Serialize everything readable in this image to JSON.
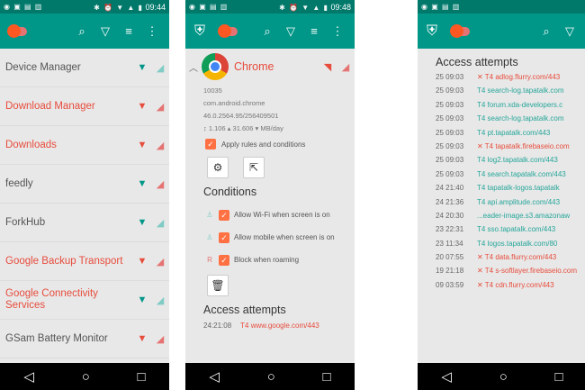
{
  "status_bar": {
    "left_icons": "◉ ▣ ▤ ▥",
    "right_icons": "✱ ⏰ ▼ ▲ ▮",
    "time_1": "09:44",
    "time_2": "09:48"
  },
  "toolbar": {
    "icons": [
      "search-icon",
      "filter-icon",
      "sort-icon",
      "overflow-menu-icon"
    ]
  },
  "navbar": {
    "back": "◁",
    "home": "○",
    "recents": "□"
  },
  "phone1": {
    "apps": [
      {
        "name": "Device Manager",
        "color": "gray",
        "wifi": "on",
        "mobile": "on"
      },
      {
        "name": "Download Manager",
        "color": "red",
        "wifi": "off",
        "mobile": "off"
      },
      {
        "name": "Downloads",
        "color": "red",
        "wifi": "off",
        "mobile": "off"
      },
      {
        "name": "feedly",
        "color": "gray",
        "wifi": "on",
        "mobile": "off"
      },
      {
        "name": "ForkHub",
        "color": "gray",
        "wifi": "on",
        "mobile": "on"
      },
      {
        "name": "Google Backup Transport",
        "color": "red",
        "wifi": "off",
        "mobile": "off"
      },
      {
        "name": "Google Connectivity Services",
        "color": "red",
        "wifi": "on",
        "mobile": "on"
      },
      {
        "name": "GSam Battery Monitor",
        "color": "gray",
        "wifi": "off",
        "mobile": "off"
      }
    ]
  },
  "phone2": {
    "app_name": "Chrome",
    "uid": "10035",
    "package": "com.android.chrome",
    "version": "46.0.2564.95/256409501",
    "traffic": "↕ 1.106 ▴ 31.606 ▾ MB/day",
    "apply_rules": "Apply rules and conditions",
    "conditions_title": "Conditions",
    "conditions": [
      "Allow Wi-Fi when screen is on",
      "Allow mobile when screen is on",
      "Block when roaming"
    ],
    "access_title": "Access attempts",
    "attempt_time": "24:21:08",
    "attempt_host": "T4 www.google.com/443"
  },
  "phone3": {
    "title": "Access attempts",
    "rows": [
      {
        "time": "25 09:03",
        "host": "✕ T4 adlog.flurry.com/443",
        "status": "blocked"
      },
      {
        "time": "25 09:03",
        "host": "T4 search-log.tapatalk.com",
        "status": "allowed"
      },
      {
        "time": "25 09:03",
        "host": "T4 forum.xda-developers.c",
        "status": "allowed"
      },
      {
        "time": "25 09:03",
        "host": "T4 search-log.tapatalk.com",
        "status": "allowed"
      },
      {
        "time": "25 09:03",
        "host": "T4 pt.tapatalk.com/443",
        "status": "allowed"
      },
      {
        "time": "25 09:03",
        "host": "✕ T4 tapatalk.firebaseio.com",
        "status": "blocked"
      },
      {
        "time": "25 09:03",
        "host": "T4 log2.tapatalk.com/443",
        "status": "allowed"
      },
      {
        "time": "25 09:03",
        "host": "T4 search.tapatalk.com/443",
        "status": "allowed"
      },
      {
        "time": "24 21:40",
        "host": "T4 tapatalk-logos.tapatalk",
        "status": "allowed"
      },
      {
        "time": "24 21:36",
        "host": "T4 api.amplitude.com/443",
        "status": "allowed"
      },
      {
        "time": "24 20:30",
        "host": "...eader-image.s3.amazonaw",
        "status": "allowed"
      },
      {
        "time": "23 22:31",
        "host": "T4 sso.tapatalk.com/443",
        "status": "allowed"
      },
      {
        "time": "23 11:34",
        "host": "T4 logos.tapatalk.com/80",
        "status": "allowed"
      },
      {
        "time": "20 07:55",
        "host": "✕ T4 data.flurry.com/443",
        "status": "blocked"
      },
      {
        "time": "19 21:18",
        "host": "✕ T4 s-softlayer.firebaseio.com",
        "status": "blocked"
      },
      {
        "time": "09 03:59",
        "host": "✕ T4 cdn.flurry.com/443",
        "status": "blocked"
      }
    ]
  },
  "colors": {
    "status_bar": "#00796b",
    "toolbar": "#009688",
    "blocked": "#e74c3c",
    "allowed": "#26a69a"
  }
}
